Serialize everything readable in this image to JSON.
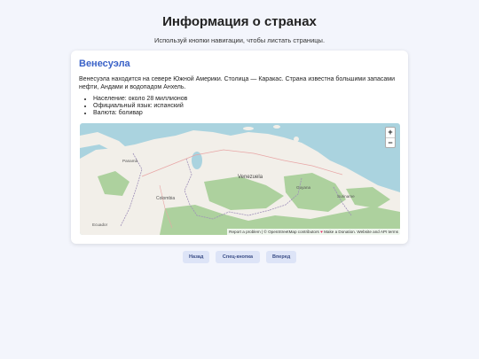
{
  "page": {
    "title": "Информация о странах",
    "subtitle": "Используй кнопки навигации, чтобы листать страницы."
  },
  "country": {
    "name": "Венесуэла",
    "description": "Венесуэла находится на севере Южной Америки. Столица — Каракас. Страна известна большими запасами нефти, Андами и водопадом Анхель.",
    "facts": [
      "Население: около 28 миллионов",
      "Официальный язык: испанский",
      "Валюта: боливар"
    ]
  },
  "map": {
    "labels": {
      "panama": "Panamá",
      "venezuela": "Venezuela",
      "colombia": "Colombia",
      "guyana": "Guyana",
      "suriname": "Suriname",
      "ecuador": "Ecuador"
    },
    "attribution": "Report a problem | © OpenStreetMap contributors",
    "donate": "Make a Donation. Website and API terms",
    "zoom_in": "+",
    "zoom_out": "−",
    "colors": {
      "water": "#aad3df",
      "land": "#f2efe9",
      "forest": "#add19e",
      "border": "#9e8fb8"
    }
  },
  "navigation": {
    "back": "Назад",
    "special": "Спец-кнопка",
    "next": "Вперед"
  }
}
